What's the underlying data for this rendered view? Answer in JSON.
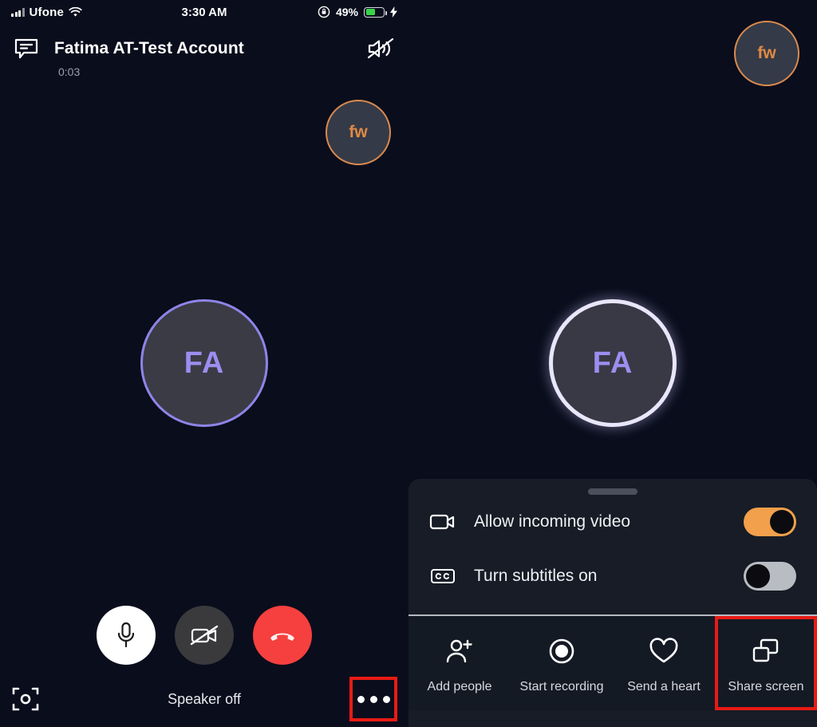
{
  "status_bar": {
    "carrier": "Ufone",
    "time": "3:30 AM",
    "battery_percent": "49%",
    "battery_level": 55,
    "wifi_icon": "wifi-icon",
    "signal_icon": "cellular-signal-icon",
    "rotation_lock_icon": "rotation-lock-icon",
    "battery_icon": "battery-icon",
    "charging_icon": "lightning-bolt-icon"
  },
  "call": {
    "chat_icon": "chat-bubble-icon",
    "contact_name": "Fatima AT-Test Account",
    "timer": "0:03",
    "speaker_mute_icon": "speaker-mute-icon",
    "self_avatar_initials": "fw",
    "remote_avatar_initials": "FA",
    "avatar_ring_color": "#8f84e8",
    "self_avatar_color": "#e08a45"
  },
  "controls": {
    "mic_icon": "microphone-icon",
    "mic_label": "Mute",
    "video_icon": "video-off-icon",
    "video_label": "Video off",
    "end_icon": "end-call-icon",
    "end_label": "End call",
    "camera_switch_icon": "camera-switch-icon",
    "speaker_status": "Speaker off",
    "more_icon": "more-options-icon",
    "more_label": "More options",
    "highlight_color": "#e81b14"
  },
  "sheet": {
    "drag_handle": "drag-handle",
    "options": [
      {
        "label": "Allow incoming video",
        "icon": "video-camera-icon",
        "toggle_state": "on",
        "toggle_color": "#f2a04b"
      },
      {
        "label": "Turn subtitles on",
        "icon": "closed-captions-icon",
        "toggle_state": "off",
        "toggle_color": "#b9bcc2"
      }
    ],
    "actions": [
      {
        "label": "Add people",
        "icon": "add-person-icon",
        "highlighted": false
      },
      {
        "label": "Start recording",
        "icon": "record-circle-icon",
        "highlighted": false
      },
      {
        "label": "Send a heart",
        "icon": "heart-icon",
        "highlighted": false
      },
      {
        "label": "Share screen",
        "icon": "share-screen-icon",
        "highlighted": true
      }
    ]
  }
}
